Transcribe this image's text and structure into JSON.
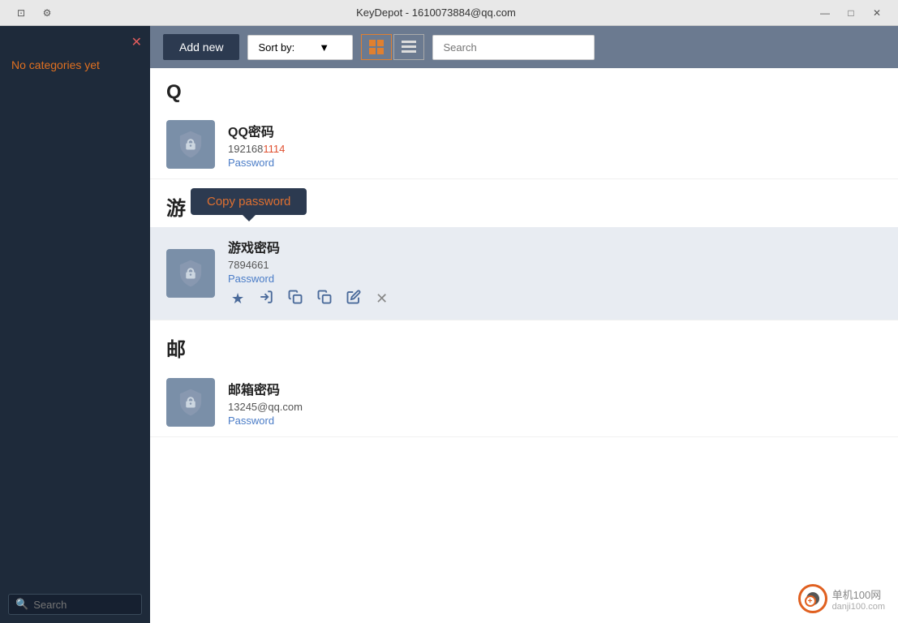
{
  "titlebar": {
    "title": "KeyDepot - 1610073884@qq.com",
    "minimize": "—",
    "maximize": "□",
    "close": "✕"
  },
  "sidebar": {
    "no_categories": "No categories yet",
    "close_icon": "✕",
    "search_placeholder": "Search"
  },
  "toolbar": {
    "add_new_label": "Add new",
    "sort_by_label": "Sort by:",
    "search_placeholder": "Search"
  },
  "categories": [
    {
      "letter": "Q",
      "items": [
        {
          "name": "QQ密码",
          "value": "1921681114",
          "value_highlight_start": 6,
          "value_highlight_end": 10,
          "type": "Password",
          "selected": false
        }
      ]
    },
    {
      "letter": "游",
      "items": [
        {
          "name": "游戏密码",
          "value": "7894661",
          "type": "Password",
          "selected": true
        }
      ]
    },
    {
      "letter": "邮",
      "items": [
        {
          "name": "邮箱密码",
          "value": "13245@qq.com",
          "type": "Password",
          "selected": false
        }
      ]
    }
  ],
  "context_menu": {
    "copy_password": "Copy password"
  },
  "action_icons": {
    "star": "★",
    "login": "→",
    "copy1": "⊞",
    "copy2": "⧉",
    "edit": "✎",
    "close": "✕"
  },
  "logo": {
    "text": "单机100网",
    "url": "danji100.com",
    "plus": "+"
  }
}
